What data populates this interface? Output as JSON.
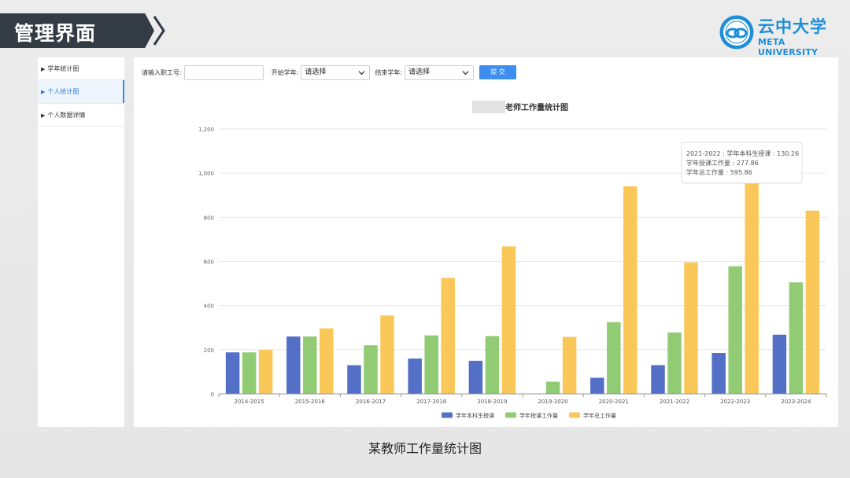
{
  "header": {
    "title": "管理界面"
  },
  "logo": {
    "name_cn": "云中大学",
    "name_en": "META UNIVERSITY"
  },
  "sidebar": {
    "items": [
      {
        "label": "学年统计图",
        "active": false
      },
      {
        "label": "个人统计图",
        "active": true
      },
      {
        "label": "个人数据详情",
        "active": false
      }
    ]
  },
  "filter": {
    "staff_id_label": "请输入职工号:",
    "staff_id_value": "",
    "start_year_label": "开始学年:",
    "start_year_value": "请选择",
    "end_year_label": "结束学年:",
    "end_year_value": "请选择",
    "submit_label": "提 交"
  },
  "caption": "某教师工作量统计图",
  "colors": {
    "series1": "#5470c6",
    "series2": "#91cc75",
    "series3": "#fac858",
    "accent": "#3d8ef0"
  },
  "chart_data": {
    "type": "bar",
    "title": "老师工作量统计图",
    "categories": [
      "2014-2015",
      "2015-2016",
      "2016-2017",
      "2017-2018",
      "2018-2019",
      "2019-2020",
      "2020-2021",
      "2021-2022",
      "2022-2023",
      "2023-2024"
    ],
    "series": [
      {
        "name": "学年本科生授课",
        "color": "#5470c6",
        "values": [
          188,
          260,
          130,
          160,
          150,
          0,
          73,
          130.26,
          185,
          268
        ]
      },
      {
        "name": "学年授课工作量",
        "color": "#91cc75",
        "values": [
          188,
          260,
          220,
          265,
          262,
          55,
          325,
          277.86,
          578,
          505
        ]
      },
      {
        "name": "学年总工作量",
        "color": "#fac858",
        "values": [
          200,
          297,
          355,
          525,
          668,
          258,
          940,
          595.86,
          990,
          830
        ]
      }
    ],
    "ylim": [
      0,
      1200
    ],
    "yticks": [
      "0",
      "200",
      "400",
      "600",
      "800",
      "1,000",
      "1,200"
    ],
    "grid": true,
    "legend": "bottom-center",
    "tooltip": {
      "line1": "2021-2022 : 学年本科生授课 : 130.26",
      "line2": "学年授课工作量 : 277.86",
      "line3": "学年总工作量 : 595.86"
    }
  }
}
